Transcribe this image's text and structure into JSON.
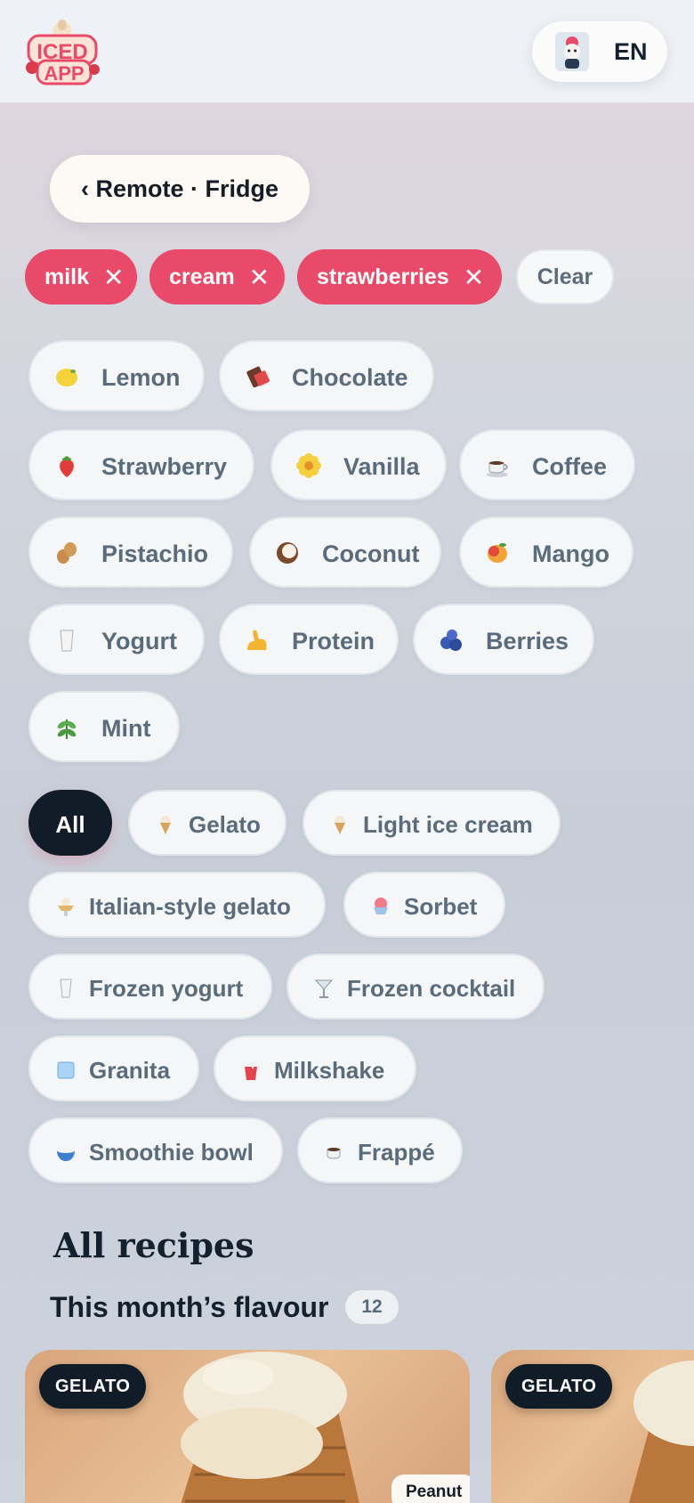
{
  "header": {
    "logo_text_top": "ICED",
    "logo_text_bottom": "APP",
    "language_label": "EN"
  },
  "breadcrumb": {
    "back_label": "‹ Remote · Fridge"
  },
  "selected_ingredients": [
    {
      "label": "milk"
    },
    {
      "label": "cream"
    },
    {
      "label": "strawberries"
    }
  ],
  "clear_label": "Clear",
  "flavors": [
    {
      "label": "Lemon",
      "icon": "lemon-icon"
    },
    {
      "label": "Chocolate",
      "icon": "chocolate-icon"
    },
    {
      "label": "Strawberry",
      "icon": "strawberry-icon"
    },
    {
      "label": "Vanilla",
      "icon": "flower-icon"
    },
    {
      "label": "Coffee",
      "icon": "coffee-cup-icon"
    },
    {
      "label": "Pistachio",
      "icon": "peanut-icon"
    },
    {
      "label": "Coconut",
      "icon": "coconut-icon"
    },
    {
      "label": "Mango",
      "icon": "mango-icon"
    },
    {
      "label": "Yogurt",
      "icon": "glass-icon"
    },
    {
      "label": "Protein",
      "icon": "flexed-arm-icon"
    },
    {
      "label": "Berries",
      "icon": "blueberries-icon"
    },
    {
      "label": "Mint",
      "icon": "herb-icon"
    }
  ],
  "categories": [
    {
      "label": "All",
      "active": true
    },
    {
      "label": "Gelato",
      "icon": "ice-cream-cone-icon"
    },
    {
      "label": "Light ice cream",
      "icon": "ice-cream-cone-icon"
    },
    {
      "label": "Italian-style gelato",
      "icon": "sundae-icon"
    },
    {
      "label": "Sorbet",
      "icon": "shaved-ice-icon"
    },
    {
      "label": "Frozen yogurt",
      "icon": "glass-icon"
    },
    {
      "label": "Frozen cocktail",
      "icon": "cocktail-icon"
    },
    {
      "label": "Granita",
      "icon": "ice-cube-icon"
    },
    {
      "label": "Milkshake",
      "icon": "cup-with-straw-icon"
    },
    {
      "label": "Smoothie bowl",
      "icon": "bowl-icon"
    },
    {
      "label": "Frappé",
      "icon": "coffee-cup-icon"
    }
  ],
  "recipes": {
    "section_title": "All recipes",
    "subtitle": "This month’s flavour",
    "count": "12",
    "cards": [
      {
        "badge": "GELATO",
        "tag": "Peanut"
      },
      {
        "badge": "GELATO"
      }
    ]
  },
  "colors": {
    "accent": "#e94a6a",
    "dark": "#101c28",
    "pill_bg": "#f4f6f8"
  }
}
